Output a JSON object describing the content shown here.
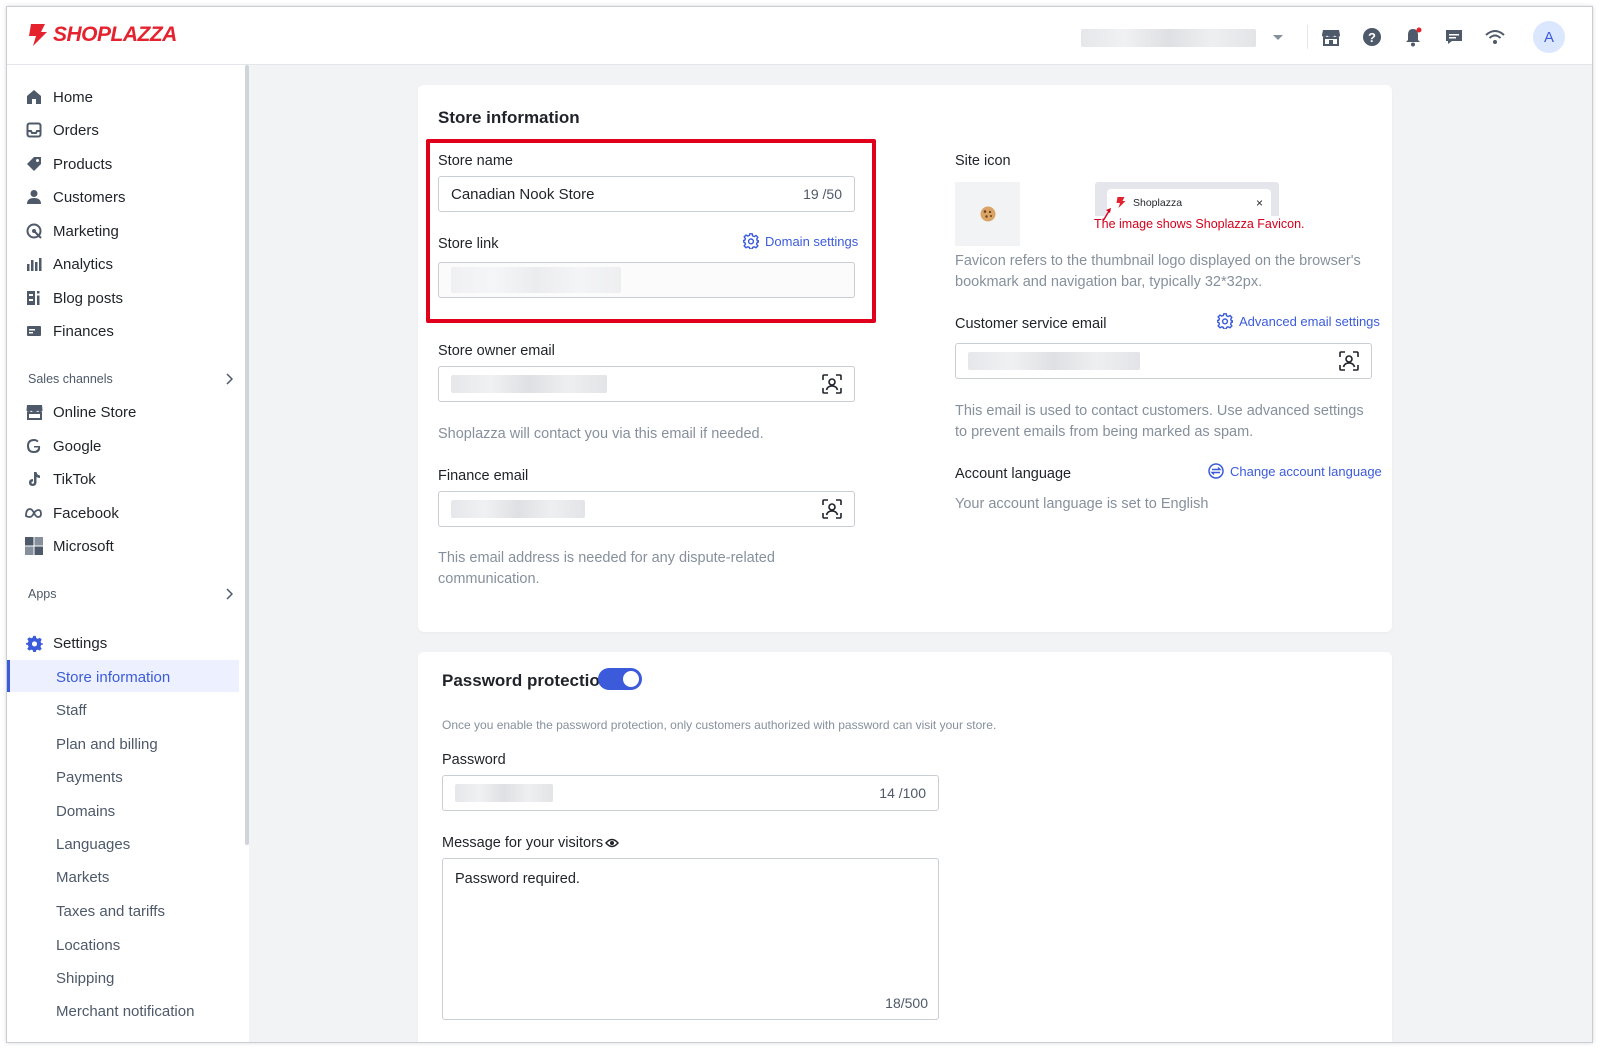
{
  "brand": {
    "name": "SHOPLAZZA",
    "color": "#e4232f",
    "accent": "#3b5bdb"
  },
  "header": {
    "avatar_initial": "A",
    "icons": [
      "storefront-icon",
      "help-icon",
      "bell-icon",
      "chat-icon",
      "wifi-icon"
    ]
  },
  "sidebar": {
    "main": [
      {
        "label": "Home",
        "icon": "home-icon"
      },
      {
        "label": "Orders",
        "icon": "orders-icon"
      },
      {
        "label": "Products",
        "icon": "tag-icon"
      },
      {
        "label": "Customers",
        "icon": "person-icon"
      },
      {
        "label": "Marketing",
        "icon": "marketing-icon"
      },
      {
        "label": "Analytics",
        "icon": "analytics-icon"
      },
      {
        "label": "Blog posts",
        "icon": "blog-icon"
      },
      {
        "label": "Finances",
        "icon": "finances-icon"
      }
    ],
    "sales_channels_label": "Sales channels",
    "channels": [
      {
        "label": "Online Store",
        "icon": "store-icon"
      },
      {
        "label": "Google",
        "icon": "google-icon"
      },
      {
        "label": "TikTok",
        "icon": "tiktok-icon"
      },
      {
        "label": "Facebook",
        "icon": "meta-icon"
      },
      {
        "label": "Microsoft",
        "icon": "microsoft-icon"
      }
    ],
    "apps_label": "Apps",
    "settings_label": "Settings",
    "settings_items": [
      "Store information",
      "Staff",
      "Plan and billing",
      "Payments",
      "Domains",
      "Languages",
      "Markets",
      "Taxes and tariffs",
      "Locations",
      "Shipping",
      "Merchant notification"
    ]
  },
  "store_info": {
    "title": "Store information",
    "store_name_label": "Store name",
    "store_name_value": "Canadian Nook Store",
    "store_name_counter": "19 /50",
    "store_link_label": "Store link",
    "domain_settings": "Domain settings",
    "owner_email_label": "Store owner email",
    "owner_email_help": "Shoplazza will contact you via this email if needed.",
    "finance_email_label": "Finance email",
    "finance_email_help": "This email address is needed for any dispute-related communication.",
    "site_icon_label": "Site icon",
    "favicon_tab_title": "Shoplazza",
    "favicon_close": "×",
    "favicon_note": "The image shows Shoplazza Favicon.",
    "favicon_help": "Favicon refers to the thumbnail logo displayed on the browser's bookmark and navigation bar, typically 32*32px.",
    "cs_email_label": "Customer service email",
    "advanced_email": "Advanced email settings",
    "cs_email_help": "This email is used to contact customers. Use advanced settings to prevent emails from being marked as spam.",
    "account_language_label": "Account language",
    "change_language": "Change account language",
    "account_language_text": "Your account language is set to English"
  },
  "password": {
    "title": "Password protection",
    "enabled": true,
    "description": "Once you enable the password protection, only customers authorized with password can visit your store.",
    "password_label": "Password",
    "password_counter": "14 /100",
    "message_label": "Message for your visitors",
    "message_value": "Password required.",
    "message_counter": "18/500"
  }
}
